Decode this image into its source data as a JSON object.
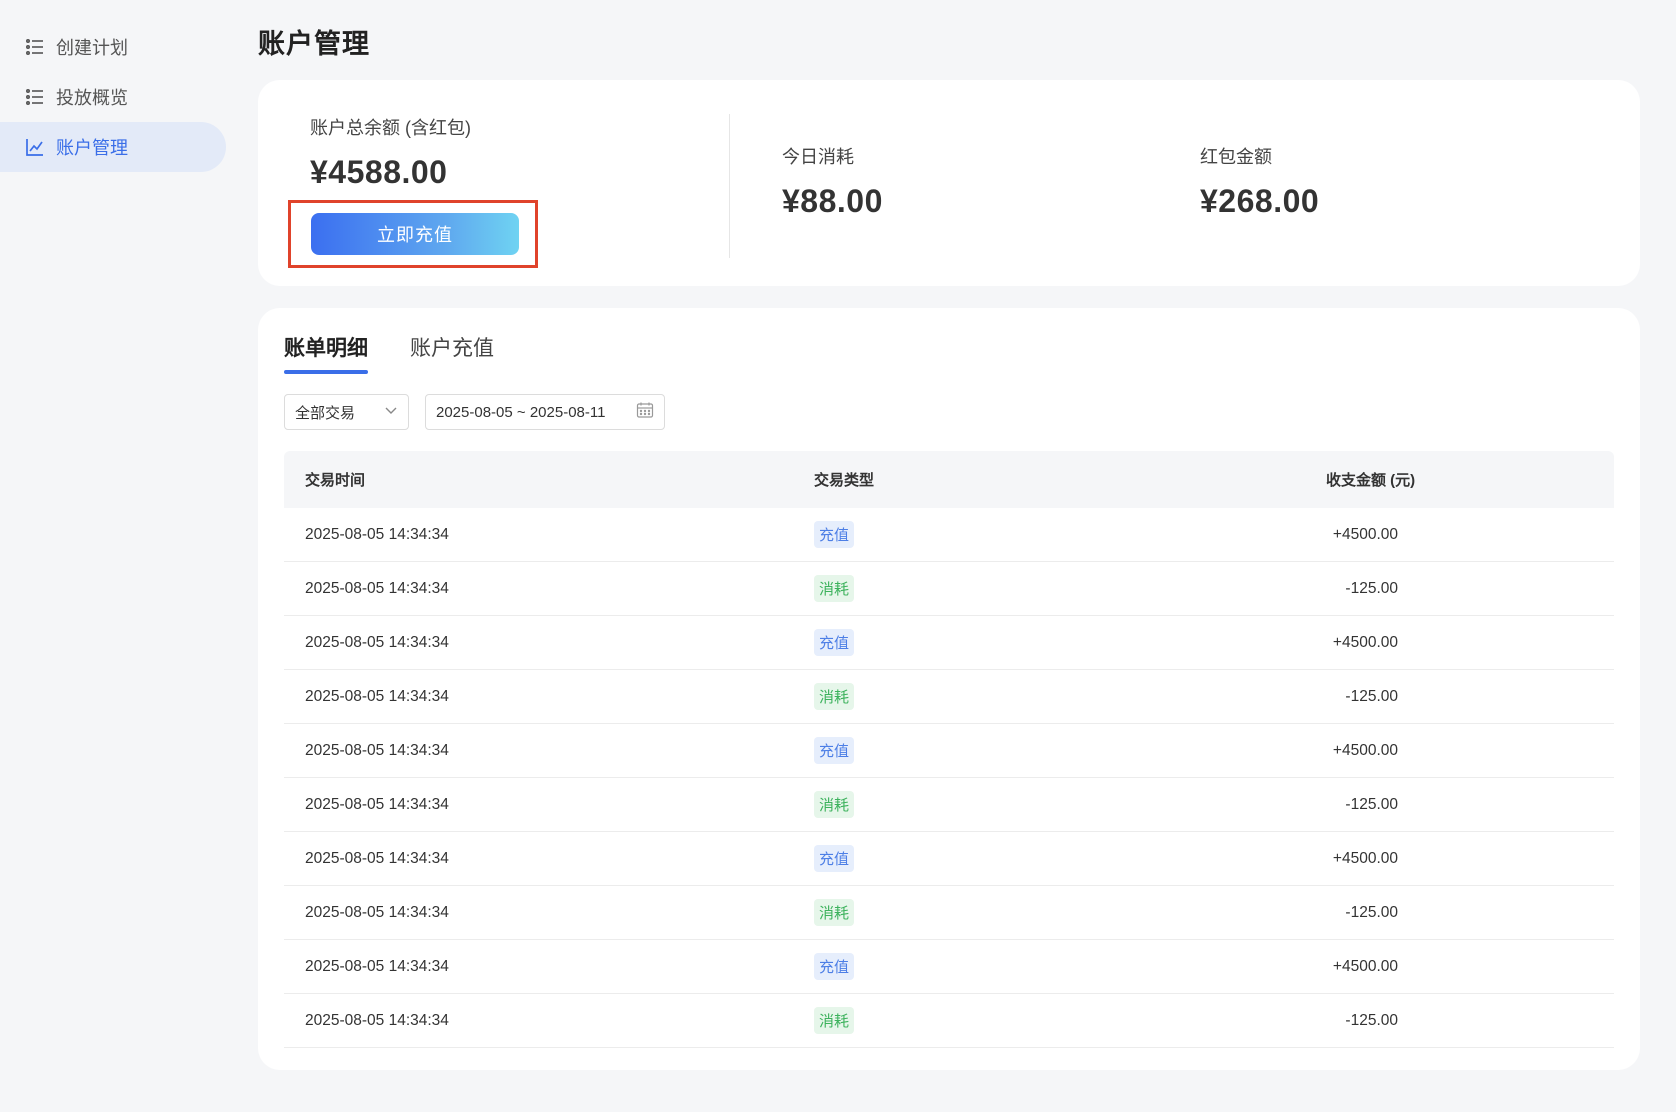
{
  "sidebar": {
    "items": [
      {
        "label": "创建计划",
        "icon": "list-icon",
        "active": false
      },
      {
        "label": "投放概览",
        "icon": "list-icon",
        "active": false
      },
      {
        "label": "账户管理",
        "icon": "chart-line-icon",
        "active": true
      }
    ]
  },
  "page": {
    "title": "账户管理"
  },
  "summary": {
    "balance_label": "账户总余额 (含红包)",
    "balance_value": "¥4588.00",
    "recharge_button": "立即充值",
    "today_label": "今日消耗",
    "today_value": "¥88.00",
    "redpacket_label": "红包金额",
    "redpacket_value": "¥268.00"
  },
  "tabs": [
    {
      "label": "账单明细",
      "active": true
    },
    {
      "label": "账户充值",
      "active": false
    }
  ],
  "filters": {
    "type_select": "全部交易",
    "date_range": "2025-08-05 ~ 2025-08-11"
  },
  "table": {
    "headers": [
      "交易时间",
      "交易类型",
      "收支金额 (元)"
    ],
    "rows": [
      {
        "time": "2025-08-05 14:34:34",
        "type": "充值",
        "amount": "+4500.00"
      },
      {
        "time": "2025-08-05 14:34:34",
        "type": "消耗",
        "amount": "-125.00"
      },
      {
        "time": "2025-08-05 14:34:34",
        "type": "充值",
        "amount": "+4500.00"
      },
      {
        "time": "2025-08-05 14:34:34",
        "type": "消耗",
        "amount": "-125.00"
      },
      {
        "time": "2025-08-05 14:34:34",
        "type": "充值",
        "amount": "+4500.00"
      },
      {
        "time": "2025-08-05 14:34:34",
        "type": "消耗",
        "amount": "-125.00"
      },
      {
        "time": "2025-08-05 14:34:34",
        "type": "充值",
        "amount": "+4500.00"
      },
      {
        "time": "2025-08-05 14:34:34",
        "type": "消耗",
        "amount": "-125.00"
      },
      {
        "time": "2025-08-05 14:34:34",
        "type": "充值",
        "amount": "+4500.00"
      },
      {
        "time": "2025-08-05 14:34:34",
        "type": "消耗",
        "amount": "-125.00"
      }
    ]
  },
  "colors": {
    "accent": "#3a6ee8",
    "highlight_box": "#e0432b",
    "recharge_badge_text": "#4d7fe6",
    "consume_badge_text": "#3cb25c"
  }
}
